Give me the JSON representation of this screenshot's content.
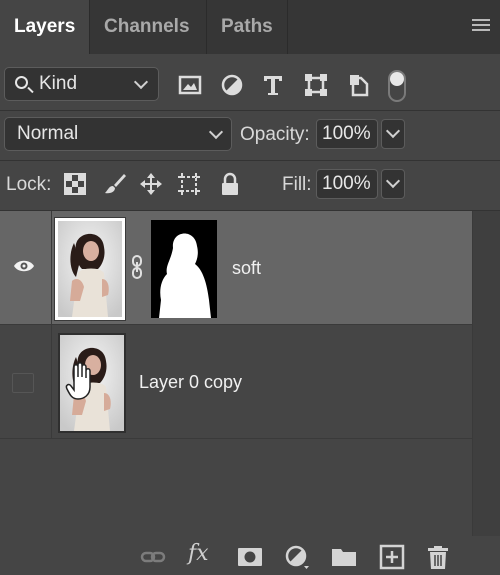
{
  "tabs": [
    {
      "label": "Layers",
      "active": true
    },
    {
      "label": "Channels",
      "active": false
    },
    {
      "label": "Paths",
      "active": false
    }
  ],
  "filter": {
    "kind_label": "Kind",
    "icons": [
      "pixel-layer-filter-icon",
      "adjustment-layer-filter-icon",
      "type-layer-filter-icon",
      "shape-layer-filter-icon",
      "smart-object-filter-icon"
    ],
    "filter_toggle_icon": "filter-toggle-icon"
  },
  "blend": {
    "mode": "Normal",
    "opacity_label": "Opacity:",
    "opacity_value": "100%"
  },
  "lock": {
    "label": "Lock:",
    "icons": [
      "lock-transparent-pixels-icon",
      "lock-image-pixels-icon",
      "lock-position-icon",
      "lock-artboard-icon",
      "lock-all-icon"
    ],
    "fill_label": "Fill:",
    "fill_value": "100%"
  },
  "layers": [
    {
      "name": "soft",
      "visible": true,
      "selected": true,
      "has_mask": true
    },
    {
      "name": "Layer 0 copy",
      "visible": false,
      "selected": false,
      "has_mask": false
    }
  ],
  "bottom_icons": [
    "link-layers-icon",
    "fx-icon",
    "add-mask-icon",
    "new-fill-adjustment-icon",
    "new-group-icon",
    "new-layer-icon",
    "delete-layer-icon"
  ],
  "fx_label": "fx",
  "colors": {
    "panel_bg": "#454545",
    "tab_bg": "#363636",
    "selected_row": "#666666"
  }
}
